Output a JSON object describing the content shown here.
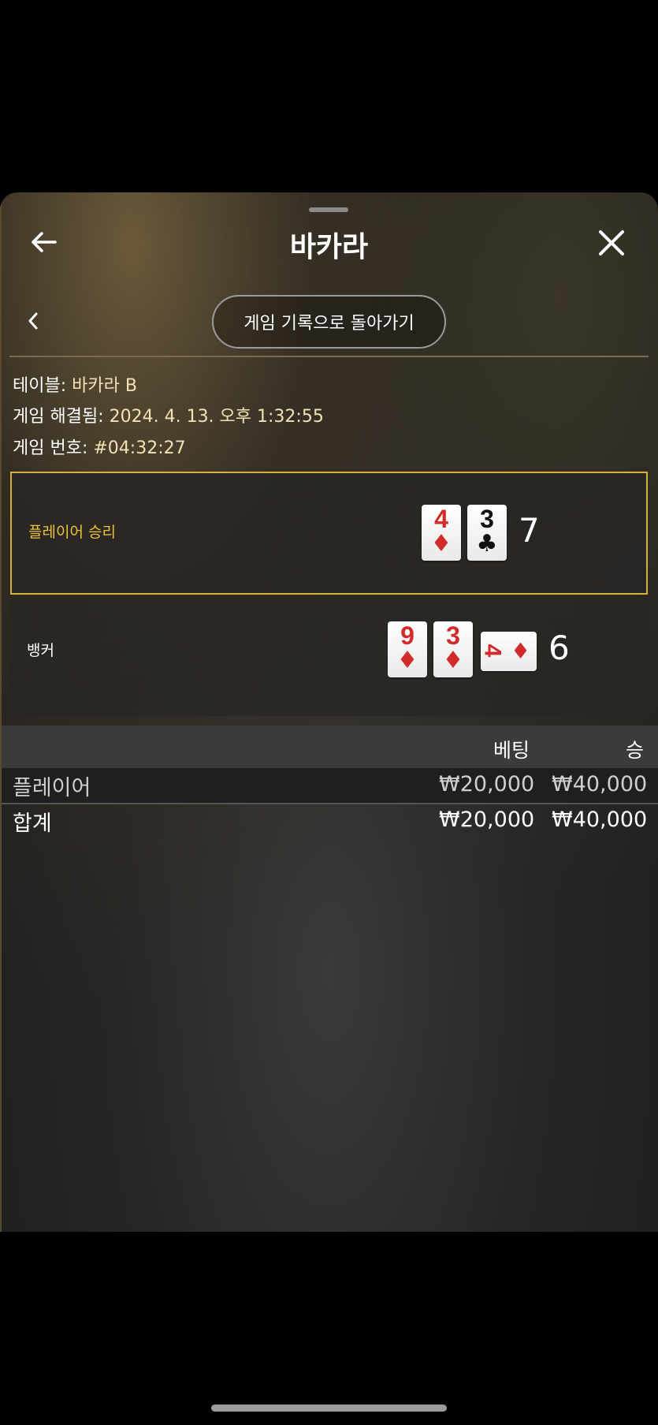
{
  "header": {
    "title": "바카라"
  },
  "nav": {
    "history_button": "게임 기록으로 돌아가기"
  },
  "info": {
    "table_label": "테이블: ",
    "table_value": "바카라 B",
    "resolved_label": "게임 해결됨: ",
    "resolved_value": "2024. 4. 13. 오후 1:32:55",
    "number_label": "게임 번호: ",
    "number_value": "#04:32:27"
  },
  "player": {
    "label": "플레이어 승리",
    "score": "7",
    "cards": [
      {
        "rank": "4",
        "suit": "♦",
        "color": "red"
      },
      {
        "rank": "3",
        "suit": "♣",
        "color": "black"
      }
    ]
  },
  "banker": {
    "label": "뱅커",
    "score": "6",
    "cards": [
      {
        "rank": "9",
        "suit": "♦",
        "color": "red"
      },
      {
        "rank": "3",
        "suit": "♦",
        "color": "red"
      },
      {
        "rank": "4",
        "suit": "♦",
        "color": "red",
        "rotated": true
      }
    ]
  },
  "bets": {
    "columns": {
      "bet": "베팅",
      "win": "승"
    },
    "rows": [
      {
        "name": "플레이어",
        "bet": "₩20,000",
        "win": "₩40,000"
      }
    ],
    "total": {
      "name": "합계",
      "bet": "₩20,000",
      "win": "₩40,000"
    }
  },
  "colors": {
    "accent_gold": "#e9c23d",
    "info_value": "#f2e2b6",
    "card_red": "#d12b2b"
  }
}
